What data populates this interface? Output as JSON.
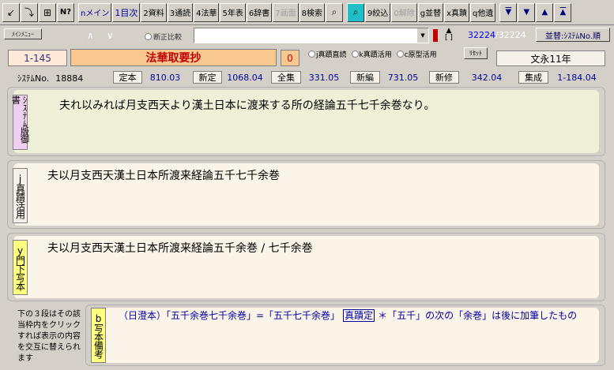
{
  "toolbar": {
    "buttons": [
      {
        "label": "↙",
        "name": "open-icon"
      },
      {
        "label": "⤵",
        "name": "import-icon"
      },
      {
        "label": "⊞",
        "name": "grid-icon"
      },
      {
        "label": "N?",
        "name": "help-icon"
      },
      {
        "label": "nメイン",
        "name": "main-button"
      },
      {
        "label": "1目次",
        "name": "contents-button"
      },
      {
        "label": "2資料",
        "name": "materials-button"
      },
      {
        "label": "3通読",
        "name": "readthrough-button"
      },
      {
        "label": "4法華",
        "name": "hokke-button"
      },
      {
        "label": "5年表",
        "name": "chronology-button"
      },
      {
        "label": "6辞書",
        "name": "dictionary-button"
      },
      {
        "label": "7画面",
        "name": "screen-button"
      },
      {
        "label": "8検索",
        "name": "search-button"
      },
      {
        "label": "⌕",
        "name": "find-icon"
      },
      {
        "label": "⌕",
        "name": "zoom-icon"
      },
      {
        "label": "9絞込",
        "name": "filter-button"
      },
      {
        "label": "0解除",
        "name": "clear-button"
      },
      {
        "label": "g並替",
        "name": "sort-button"
      },
      {
        "label": "x真蹟",
        "name": "autograph-button"
      },
      {
        "label": "q他遺",
        "name": "other-button"
      }
    ],
    "nav": [
      "▼",
      "▼",
      "▲",
      "▲"
    ]
  },
  "row2": {
    "main_menu": "ﾒｲﾝﾒﾆｭｰ",
    "up": "∧",
    "down": "∨",
    "compare_label": "断正比較",
    "counter_current": "32224",
    "counter_total": "/32224",
    "sort_label": "並替:ｼｽﾃﾑNo.順"
  },
  "header": {
    "id": "1-145",
    "title": "法華取要抄",
    "zero": "0",
    "radio_options": [
      "j真蹟直読",
      "k真蹟活用",
      "c原型活用"
    ],
    "reset": "ﾘｾｯﾄ",
    "era": "文永11年"
  },
  "sysinfo": {
    "sys_label": "ｼｽﾃﾑNo.",
    "sys_value": "18884",
    "fields": [
      {
        "label": "定本",
        "value": "810.03"
      },
      {
        "label": "新定",
        "value": "1068.04"
      },
      {
        "label": "全集",
        "value": "331.05"
      },
      {
        "label": "新編",
        "value": "731.05"
      },
      {
        "label": "新修",
        "value": "342.04"
      },
      {
        "label": "集成",
        "value": "1-184.04"
      }
    ]
  },
  "panels": {
    "system": {
      "label": "ｼｽﾃﾑ版御書",
      "text": "夫れ以みれば月支西天より漢土日本に渡来する所の経論五千七千余巻なり。"
    },
    "autograph": {
      "label": "j真蹟活用",
      "text": "夫以月支西天漢土日本所渡来経論五千七千余巻"
    },
    "disciple": {
      "label": "y門下写本",
      "text": "夫以月支西天漢土日本所渡来経論五千余巻 / 七千余巻"
    },
    "note": {
      "label": "b写本備考",
      "text": "（日澄本）「五千余巻七千余巻」=「五千七千余巻」",
      "badge": "真蹟定",
      "text2": "＊「五千」の次の「余巻」は後に加筆したもの"
    }
  },
  "sidenote": "下の３段はその該当枠内をクリックすれば表示の内容を交互に替えられます",
  "colors": {
    "panel1_bg": "#f0f0d8",
    "panel_bg": "#fbf5e9",
    "label1_bg": "#f0d0f0",
    "label2_bg": "#f5f0e8",
    "label3_bg": "#ffff80",
    "accent_red": "#c00000",
    "accent_blue": "#0000a0"
  }
}
